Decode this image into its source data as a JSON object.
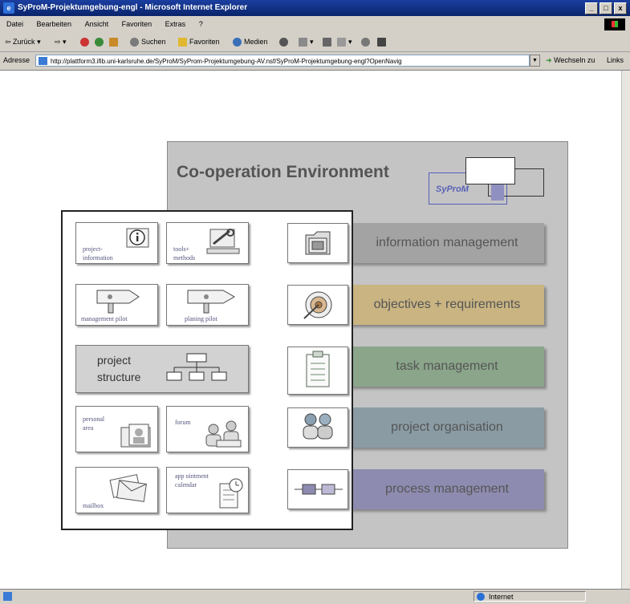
{
  "window": {
    "title": "SyProM-Projektumgebung-engl - Microsoft Internet Explorer",
    "controls": [
      "_",
      "□",
      "x"
    ]
  },
  "menu": [
    "Datei",
    "Bearbeiten",
    "Ansicht",
    "Favoriten",
    "Extras",
    "?"
  ],
  "toolbar": {
    "back": "Zurück",
    "search": "Suchen",
    "favorites": "Favoriten",
    "media": "Medien"
  },
  "address": {
    "label": "Adresse",
    "url": "http://plattform3.ifib.uni-karlsruhe.de/SyProM/SyProm-Projektumgebung-AV.nsf/SyProM-Projektumgebung-engl?OpenNavig",
    "go": "Wechseln zu",
    "links": "Links"
  },
  "status": {
    "zone": "Internet"
  },
  "diagram": {
    "title": "Co-operation Environment",
    "logo": "SyProM",
    "tiles": {
      "project_information": "project-\ninformation",
      "tools_methods": "tools+\nmethods",
      "management_pilot": "management pilot",
      "planing_pilot": "planing pilot",
      "project_structure": "project\nstructure",
      "personal_area": "personal\narea",
      "forum": "forum",
      "mailbox": "mailbox",
      "appointment_calendar": "app ointment\ncalendar"
    },
    "bars": [
      {
        "label": "information management",
        "color": "#a3a3a3"
      },
      {
        "label": "objectives + requirements",
        "color": "#c9b482"
      },
      {
        "label": "task management",
        "color": "#8aa58a"
      },
      {
        "label": "project organisation",
        "color": "#8a9ba4"
      },
      {
        "label": "process management",
        "color": "#8e8bb0"
      }
    ]
  }
}
